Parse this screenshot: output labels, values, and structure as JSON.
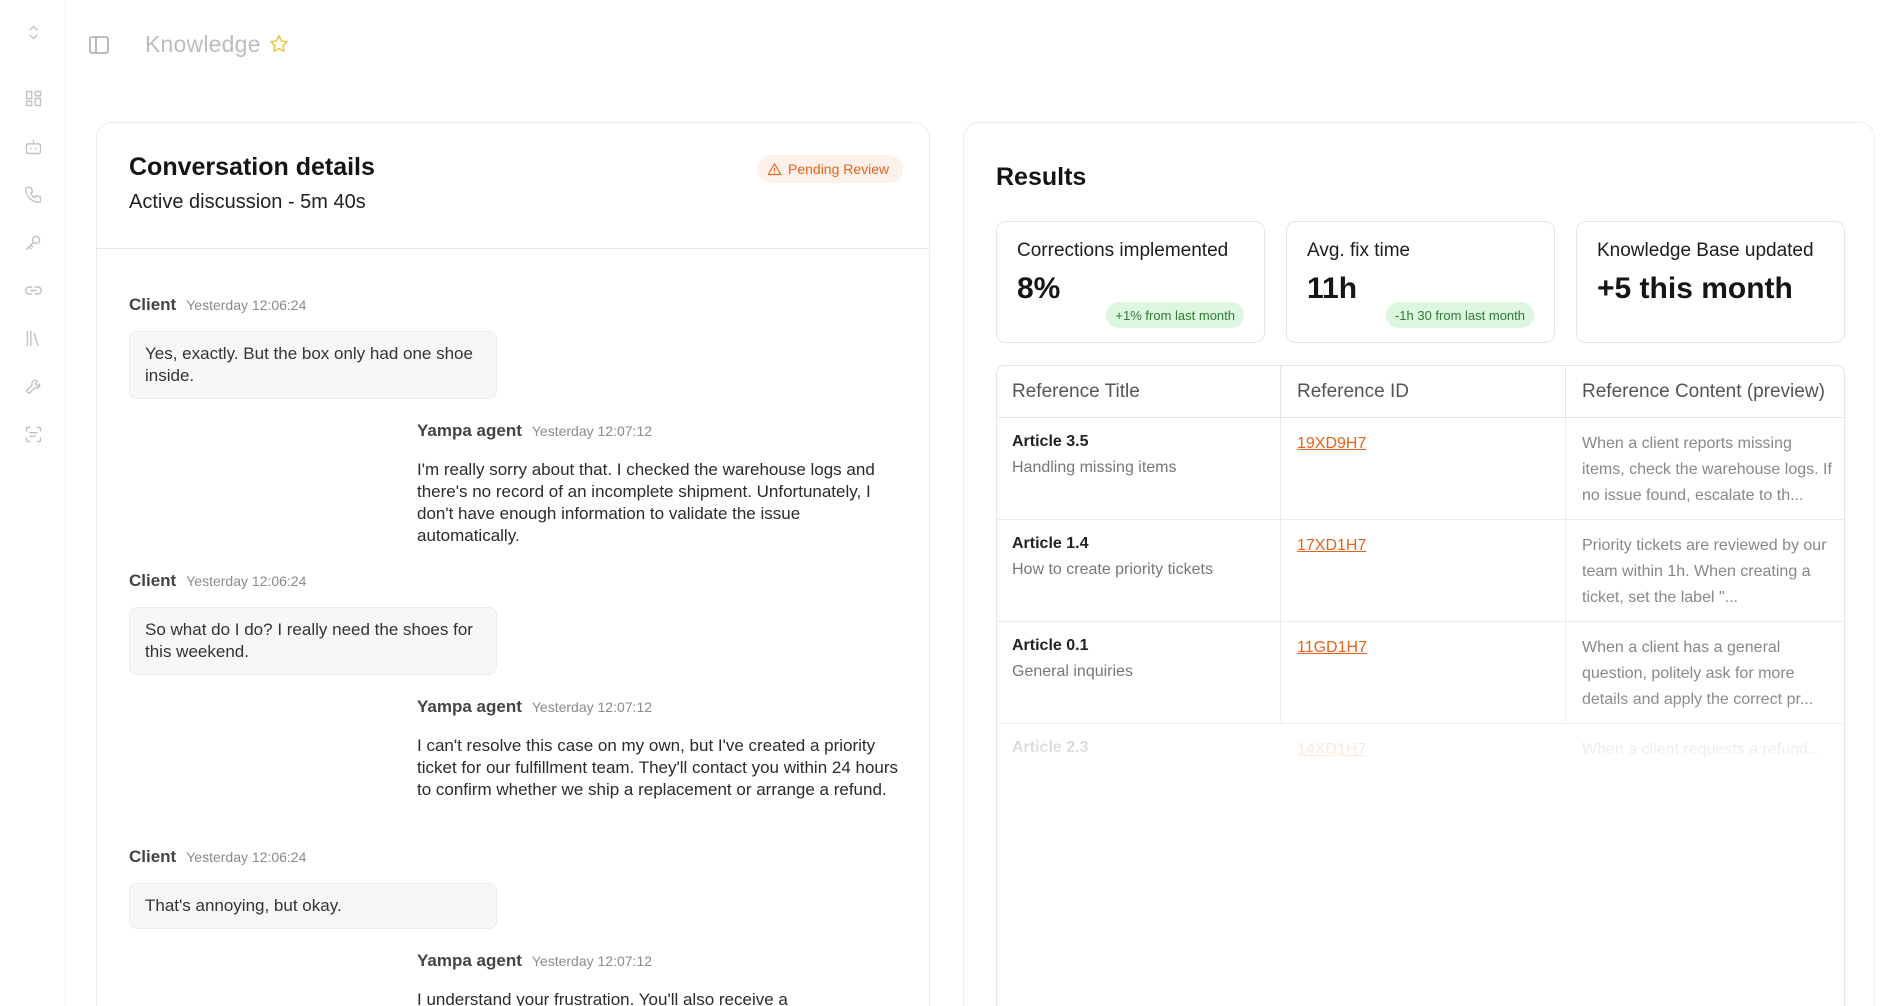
{
  "rail": {
    "icons": [
      "chevron-up-down-icon",
      "dashboard-icon",
      "bot-icon",
      "phone-icon",
      "key-icon",
      "link-icon",
      "library-icon",
      "wrench-icon",
      "scan-text-icon"
    ]
  },
  "header": {
    "title": "Knowledge"
  },
  "conversation": {
    "title": "Conversation details",
    "subtitle": "Active discussion - 5m 40s",
    "status_badge": "Pending Review",
    "messages": [
      {
        "author": "Client",
        "time": "Yesterday 12:06:24",
        "text": "Yes, exactly. But the box only had one shoe inside."
      },
      {
        "author": "Yampa agent",
        "time": "Yesterday 12:07:12",
        "text": "I'm really sorry about that. I checked the warehouse logs and there's no record of an incomplete shipment. Unfortunately, I don't have enough information to validate the issue automatically."
      },
      {
        "author": "Client",
        "time": "Yesterday 12:06:24",
        "text": "So what do I do? I really need the shoes for this weekend."
      },
      {
        "author": "Yampa agent",
        "time": "Yesterday 12:07:12",
        "text": "I can't resolve this case on my own, but I've created a priority ticket for our fulfillment team. They'll contact you within 24 hours to confirm whether we ship a replacement or arrange a refund."
      },
      {
        "author": "Client",
        "time": "Yesterday 12:06:24",
        "text": "That's annoying, but okay."
      },
      {
        "author": "Yampa agent",
        "time": "Yesterday 12:07:12",
        "text": "I understand your frustration. You'll also receive a"
      }
    ]
  },
  "results": {
    "title": "Results",
    "stats": [
      {
        "label": "Corrections implemented",
        "value": "8%",
        "delta": "+1% from last month"
      },
      {
        "label": "Avg. fix time",
        "value": "11h",
        "delta": "-1h 30 from last month"
      },
      {
        "label": "Knowledge Base updated",
        "value": "+5 this month",
        "delta": ""
      }
    ],
    "table": {
      "headers": [
        "Reference Title",
        "Reference ID",
        "Reference Content (preview)"
      ],
      "rows": [
        {
          "title": "Article 3.5",
          "subtitle": "Handling missing items",
          "id": "19XD9H7",
          "content": "When a client reports missing items, check the warehouse logs. If no issue found, escalate to th..."
        },
        {
          "title": "Article 1.4",
          "subtitle": "How to create priority tickets",
          "id": "17XD1H7",
          "content": "Priority tickets are reviewed by our team within 1h. When creating a ticket, set the label \"..."
        },
        {
          "title": "Article 0.1",
          "subtitle": "General inquiries",
          "id": "11GD1H7",
          "content": "When a client has a general question, politely ask for more details and apply the correct pr..."
        },
        {
          "title": "Article 2.3",
          "subtitle": "",
          "id": "14XD1H7",
          "content": "When a client requests a refund..."
        }
      ]
    }
  },
  "colors": {
    "accent": "#e4631d",
    "success_bg": "#ddf6df",
    "success_text": "#2e7d32",
    "star": "#eac54a"
  }
}
